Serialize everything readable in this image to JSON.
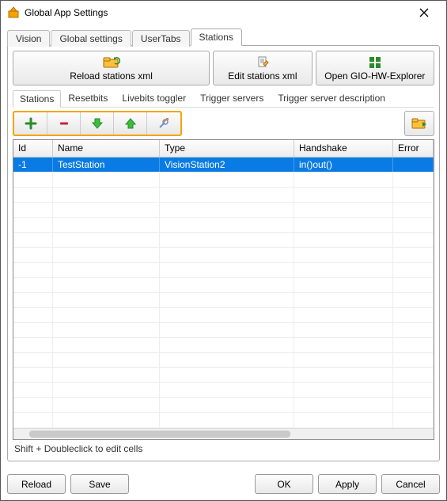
{
  "window": {
    "title": "Global App Settings"
  },
  "outerTabs": [
    "Vision",
    "Global settings",
    "UserTabs",
    "Stations"
  ],
  "outerActiveIndex": 3,
  "topButtons": {
    "reload": "Reload stations xml",
    "edit": "Edit stations xml",
    "open": "Open GIO-HW-Explorer"
  },
  "innerTabs": [
    "Stations",
    "Resetbits",
    "Livebits toggler",
    "Trigger servers",
    "Trigger server description"
  ],
  "innerActiveIndex": 0,
  "toolbar": {
    "icons": [
      "add-icon",
      "remove-icon",
      "move-down-icon",
      "move-up-icon",
      "tools-icon"
    ],
    "right": "folder-icon"
  },
  "grid": {
    "columns": [
      "Id",
      "Name",
      "Type",
      "Handshake",
      "Error"
    ],
    "rows": [
      {
        "id": "-1",
        "name": "TestStation",
        "type": "VisionStation2",
        "handshake": "in()out()",
        "error": ""
      }
    ],
    "selectedIndex": 0
  },
  "hint": "Shift + Doubleclick to edit cells",
  "bottom": {
    "reload": "Reload",
    "save": "Save",
    "ok": "OK",
    "apply": "Apply",
    "cancel": "Cancel"
  }
}
